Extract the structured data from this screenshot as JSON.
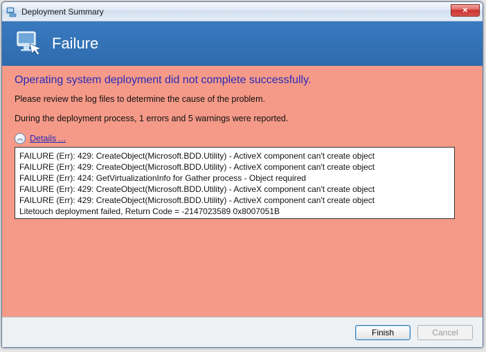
{
  "window": {
    "title": "Deployment Summary"
  },
  "banner": {
    "text": "Failure"
  },
  "content": {
    "headline": "Operating system deployment did not complete successfully.",
    "instruction": "Please review the log files to determine the cause of the problem.",
    "summary": "During the deployment process, 1 errors and 5 warnings were reported.",
    "details_label": "Details ...",
    "log_lines": [
      "FAILURE (Err): 429: CreateObject(Microsoft.BDD.Utility) - ActiveX component can't create object",
      "FAILURE (Err): 429: CreateObject(Microsoft.BDD.Utility) - ActiveX component can't create object",
      "FAILURE (Err): 424: GetVirtualizationInfo for Gather process - Object required",
      "FAILURE (Err): 429: CreateObject(Microsoft.BDD.Utility) - ActiveX component can't create object",
      "FAILURE (Err): 429: CreateObject(Microsoft.BDD.Utility) - ActiveX component can't create object",
      "Litetouch deployment failed, Return Code = -2147023589  0x8007051B"
    ]
  },
  "footer": {
    "finish": "Finish",
    "cancel": "Cancel"
  }
}
